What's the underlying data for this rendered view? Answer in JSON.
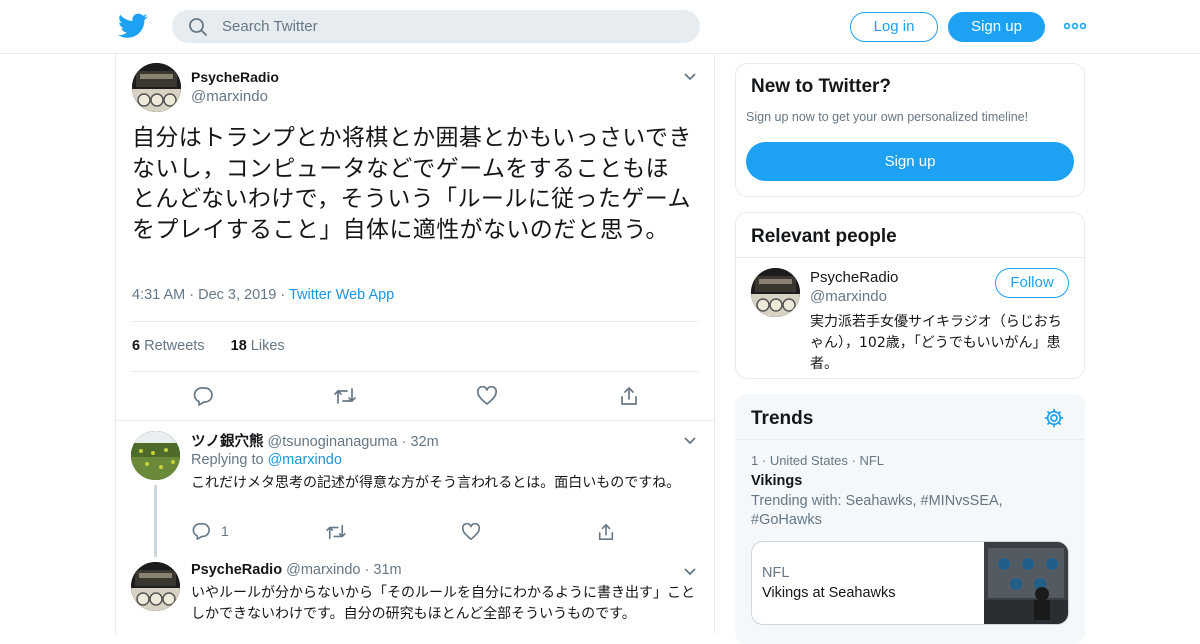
{
  "header": {
    "search_placeholder": "Search Twitter",
    "login_label": "Log in",
    "signup_label": "Sign up",
    "brand_color": "#1da1f2"
  },
  "tweet": {
    "name": "PsycheRadio",
    "handle": "@marxindo",
    "text": "自分はトランプとか将棋とか囲碁とかもいっさいできないし，コンピュータなどでゲームをすることもほとんどないわけで，そういう「ルールに従ったゲームをプレイすること」自体に適性がないのだと思う。",
    "time": "4:31 AM",
    "date": "Dec 3, 2019",
    "source": "Twitter Web App",
    "retweets_count": "6",
    "retweets_label": "Retweets",
    "likes_count": "18",
    "likes_label": "Likes"
  },
  "replies": [
    {
      "name": "ツノ銀穴熊",
      "handle": "@tsunoginanaguma",
      "time": "32m",
      "replying_prefix": "Replying to",
      "replying_to": "@marxindo",
      "text": "これだけメタ思考の記述が得意な方がそう言われるとは。面白いものですね。",
      "reply_count": "1"
    },
    {
      "name": "PsycheRadio",
      "handle": "@marxindo",
      "time": "31m",
      "text": "いやルールが分からないから「そのルールを自分にわかるように書き出す」ことしかできないわけです。自分の研究もほとんど全部そういうものです。"
    }
  ],
  "new_to_twitter": {
    "title": "New to Twitter?",
    "subtitle": "Sign up now to get your own personalized timeline!",
    "button": "Sign up"
  },
  "relevant_people": {
    "title": "Relevant people",
    "name": "PsycheRadio",
    "handle": "@marxindo",
    "follow_label": "Follow",
    "bio": "実力派若手女優サイキラジオ（らじおちゃん），102歳，「どうでもいいがん」患者。"
  },
  "trends": {
    "title": "Trends",
    "rank": "1",
    "location": "United States",
    "category": "NFL",
    "name": "Vikings",
    "trending_with": "Trending with: Seahawks, #MINvsSEA, #GoHawks",
    "card_category": "NFL",
    "card_title": "Vikings at Seahawks"
  }
}
